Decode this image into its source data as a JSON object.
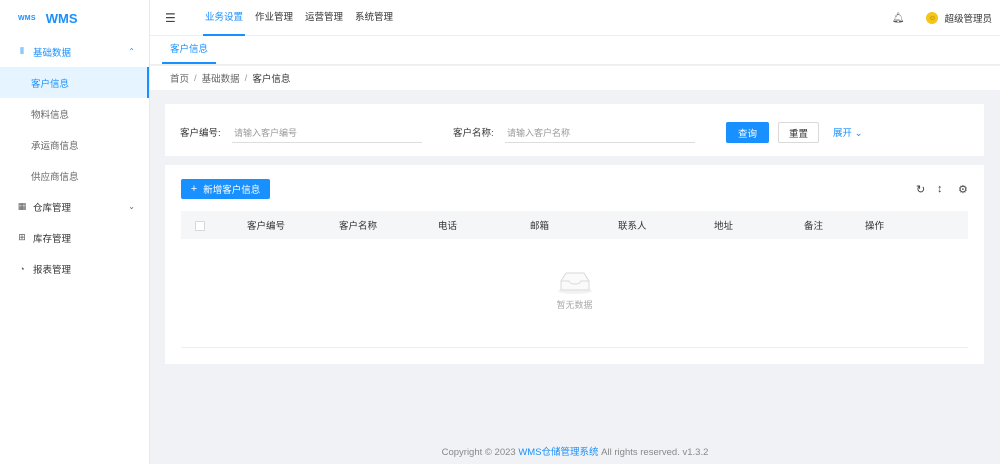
{
  "app": {
    "logo_mark": "WMS",
    "title": "WMS"
  },
  "sidebar": {
    "groups": [
      {
        "label": "基础数据",
        "icon": "data-icon",
        "arrow": "^",
        "items": [
          {
            "label": "客户信息",
            "active": true
          },
          {
            "label": "物料信息",
            "active": false
          },
          {
            "label": "承运商信息",
            "active": false
          },
          {
            "label": "供应商信息",
            "active": false
          }
        ]
      },
      {
        "label": "仓库管理",
        "icon": "warehouse-icon",
        "arrow": "v"
      },
      {
        "label": "库存管理",
        "icon": "inventory-icon"
      },
      {
        "label": "报表管理",
        "icon": "report-icon"
      }
    ]
  },
  "header": {
    "collapse_icon": "menu-fold-icon",
    "menu": [
      "业务设置",
      "作业管理",
      "运营管理",
      "系统管理"
    ],
    "active_menu": 0,
    "bell_icon": "bell-icon",
    "user": "超级管理员"
  },
  "tabs": [
    "客户信息"
  ],
  "breadcrumb": {
    "items": [
      "首页",
      "基础数据",
      "客户信息"
    ],
    "separator": "/"
  },
  "search": {
    "customer_code_label": "客户编号:",
    "customer_code_placeholder": "请输入客户编号",
    "customer_name_label": "客户名称:",
    "customer_name_placeholder": "请输入客户名称",
    "query_button": "查询",
    "reset_button": "重置",
    "expand_link": "展开"
  },
  "table": {
    "add_button": "新增客户信息",
    "tools": [
      "reload-icon",
      "density-icon",
      "settings-icon"
    ],
    "columns": [
      "客户编号",
      "客户名称",
      "电话",
      "邮箱",
      "联系人",
      "地址",
      "备注",
      "操作"
    ],
    "empty_text": "暂无数据"
  },
  "footer": {
    "prefix": "Copyright © 2023 ",
    "brand": "WMS仓储管理系统",
    "suffix": " All rights reserved. v1.3.2"
  },
  "colors": {
    "primary": "#1890ff",
    "background": "#f0f2f5"
  }
}
